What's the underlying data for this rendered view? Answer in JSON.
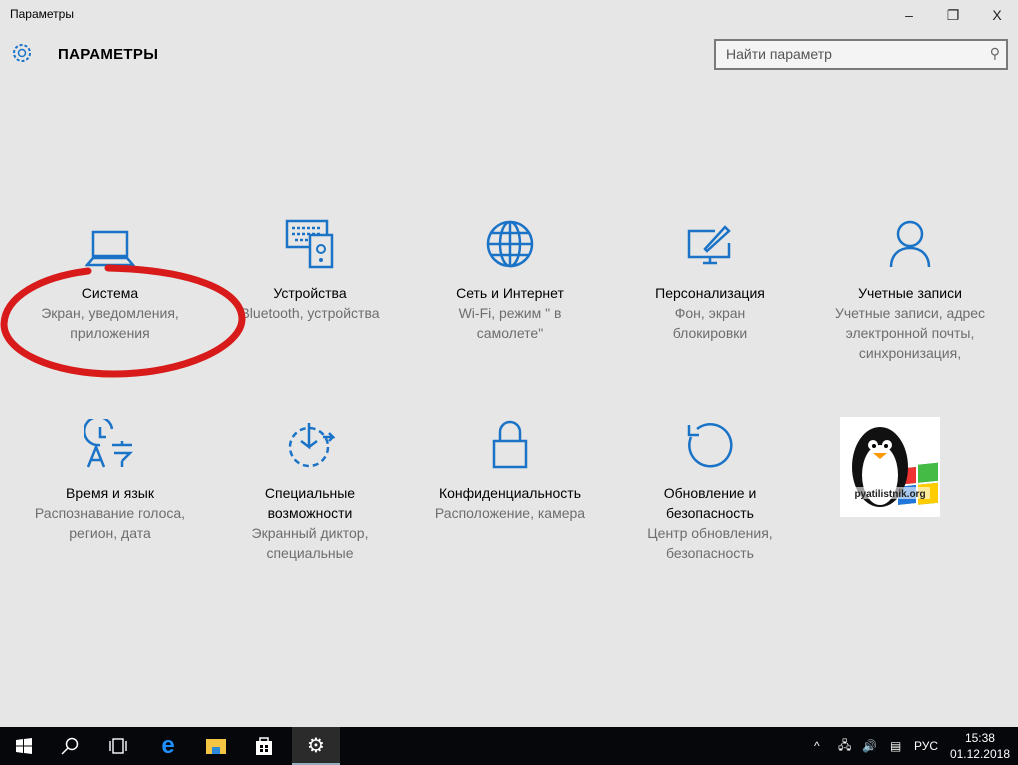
{
  "window": {
    "title": "Параметры",
    "minimize": "–",
    "restore": "❐",
    "close": "X"
  },
  "header": {
    "title": "ПАРАМЕТРЫ",
    "search_placeholder": "Найти параметр"
  },
  "tiles": [
    {
      "title": "Система",
      "subtitle": "Экран, уведомления, приложения",
      "icon": "laptop-icon"
    },
    {
      "title": "Устройства",
      "subtitle": "Bluetooth, устройства",
      "icon": "devices-icon"
    },
    {
      "title": "Сеть и Интернет",
      "subtitle": "Wi-Fi, режим \" в самолете\"",
      "icon": "globe-icon"
    },
    {
      "title": "Персонализация",
      "subtitle": "Фон, экран блокировки",
      "icon": "paint-icon"
    },
    {
      "title": "Учетные записи",
      "subtitle": "Учетные записи, адрес электронной почты, синхронизация,",
      "icon": "person-icon"
    },
    {
      "title": "Время и язык",
      "subtitle": "Распознавание голоса, регион, дата",
      "icon": "time-language-icon"
    },
    {
      "title": "Специальные возможности",
      "subtitle": "Экранный диктор, специальные",
      "icon": "accessibility-icon"
    },
    {
      "title": "Конфиденциальность",
      "subtitle": "Расположение, камера",
      "icon": "lock-icon"
    },
    {
      "title": "Обновление и безопасность",
      "subtitle": "Центр обновления, безопасность",
      "icon": "update-icon"
    }
  ],
  "logo": {
    "text": "pyatilistnik.org"
  },
  "accent": "#1a73c7",
  "taskbar": {
    "lang": "РУС",
    "time": "15:38",
    "date": "01.12.2018"
  }
}
